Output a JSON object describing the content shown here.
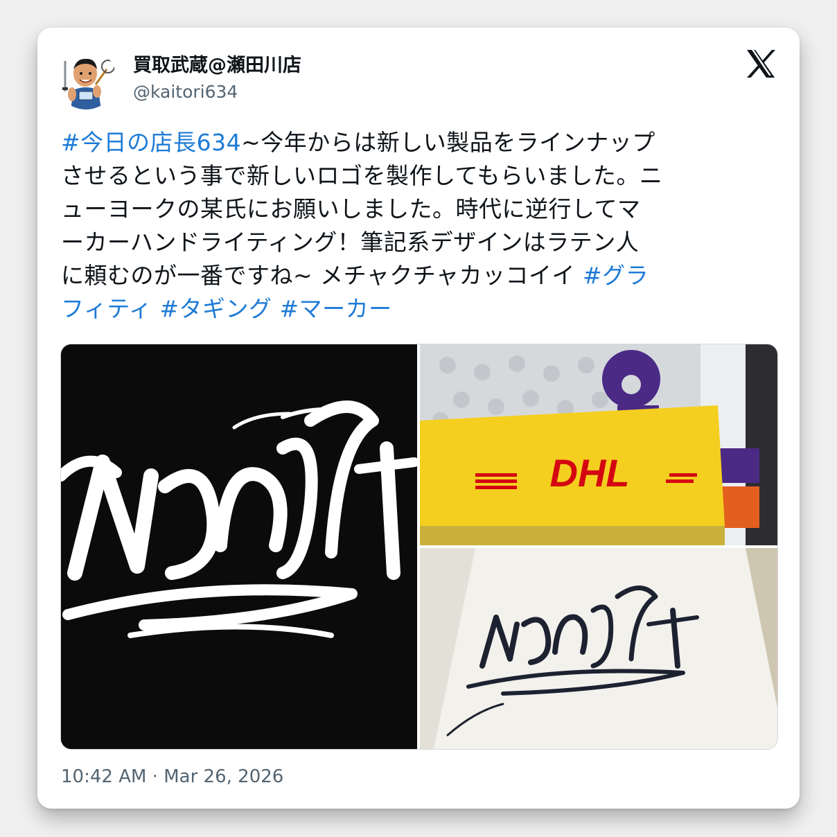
{
  "tweet": {
    "display_name": "買取武蔵@瀬田川店",
    "handle": "@kaitori634",
    "text_lines": [
      [
        {
          "text": "#今日の店長634",
          "hashtag": true
        },
        {
          "text": "~今年からは新しい製品をラインナップ",
          "hashtag": false
        }
      ],
      [
        {
          "text": "させるという事で新しいロゴを製作してもらいました。ニ",
          "hashtag": false
        }
      ],
      [
        {
          "text": "ューヨークの某氏にお願いしました。時代に逆行してマ",
          "hashtag": false
        }
      ],
      [
        {
          "text": "ーカーハンドライティング！筆記系デザインはラテン人",
          "hashtag": false
        }
      ],
      [
        {
          "text": "に頼むのが一番ですね~ メチャクチャカッコイイ ",
          "hashtag": false
        },
        {
          "text": "#グラ",
          "hashtag": true
        }
      ],
      [
        {
          "text": "フィティ",
          "hashtag": true
        },
        {
          "text": " ",
          "hashtag": false
        },
        {
          "text": "#タギング",
          "hashtag": true
        },
        {
          "text": " ",
          "hashtag": false
        },
        {
          "text": "#マーカー",
          "hashtag": true
        }
      ]
    ],
    "timestamp": {
      "time": "10:42 AM",
      "separator": " · ",
      "date": "Mar 26, 2026"
    },
    "media": {
      "dhl_label": "DHL"
    }
  },
  "colors": {
    "hashtag": "#1d7bd6",
    "text": "#0f1419",
    "muted": "#536471",
    "dhl_yellow": "#f4cf20",
    "dhl_red": "#d40511"
  },
  "icons": {
    "brand": "x-logo-icon"
  }
}
